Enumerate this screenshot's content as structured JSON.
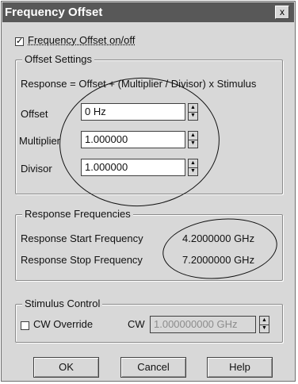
{
  "window": {
    "title": "Frequency Offset",
    "close_glyph": "x"
  },
  "enable": {
    "label": "Frequency Offset on/off",
    "checked": true,
    "check_glyph": "✓"
  },
  "offset_settings": {
    "title": "Offset Settings",
    "formula": "Response  =  Offset + (Multiplier / Divisor) x Stimulus",
    "offset": {
      "label": "Offset",
      "value": "0 Hz"
    },
    "multiplier": {
      "label": "Multiplier",
      "value": "1.000000"
    },
    "divisor": {
      "label": "Divisor",
      "value": "1.000000"
    }
  },
  "response_frequencies": {
    "title": "Response Frequencies",
    "start": {
      "label": "Response Start Frequency",
      "value": "4.2000000 GHz"
    },
    "stop": {
      "label": "Response Stop Frequency",
      "value": "7.2000000 GHz"
    }
  },
  "stimulus_control": {
    "title": "Stimulus Control",
    "cw_override": {
      "label": "CW Override",
      "checked": false
    },
    "cw": {
      "label": "CW",
      "value": "1.000000000 GHz"
    }
  },
  "buttons": {
    "ok": "OK",
    "cancel": "Cancel",
    "help": "Help"
  },
  "spinner": {
    "up_glyph": "▲",
    "down_glyph": "▼"
  }
}
